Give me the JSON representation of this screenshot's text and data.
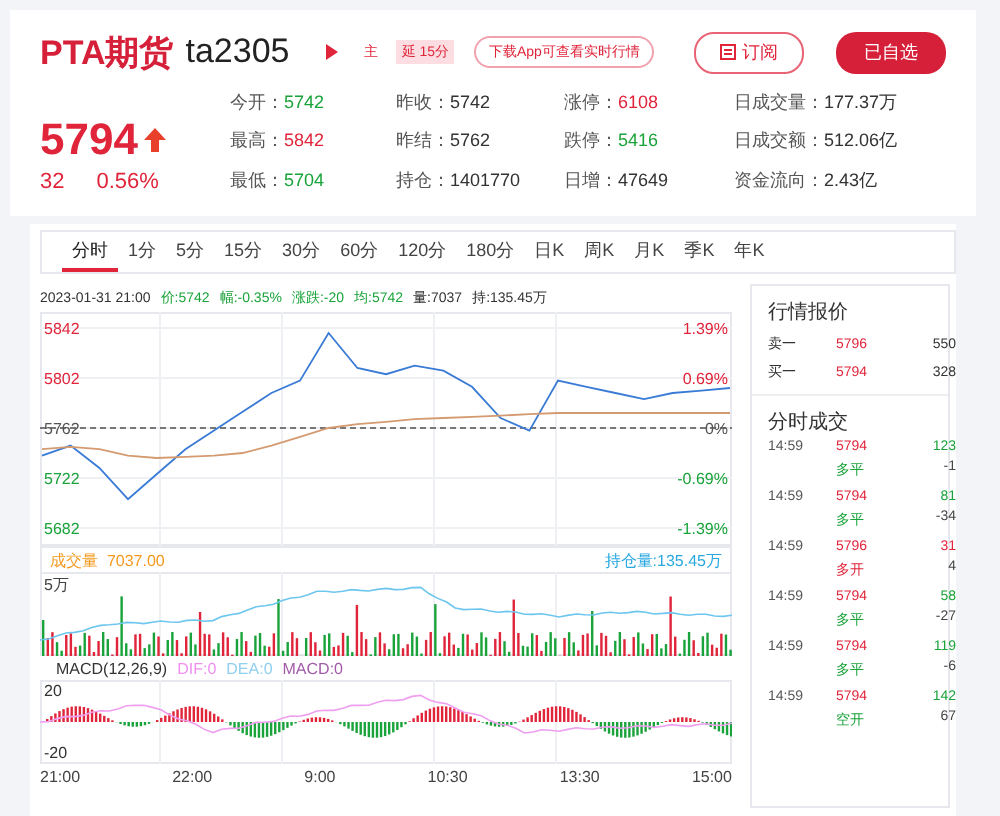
{
  "header": {
    "name": "PTA期货",
    "code": "ta2305",
    "badges": [
      {
        "text": "主",
        "kind": "plain"
      },
      {
        "text": "延 15分",
        "kind": "filled"
      }
    ],
    "promo": "下载App可查看实时行情",
    "subscribe_button": "订阅",
    "watchlist_button": "已自选"
  },
  "quote": {
    "price": "5794",
    "change": "32",
    "change_pct": "0.56%",
    "rising": true
  },
  "stats": [
    {
      "label": "今开：",
      "value": "5742",
      "color": "#1aa33a"
    },
    {
      "label": "昨收：",
      "value": "5742",
      "color": "#333333"
    },
    {
      "label": "涨停：",
      "value": "6108",
      "color": "#e0243a"
    },
    {
      "label": "日成交量：",
      "value": "177.37万",
      "color": "#333333"
    },
    {
      "label": "最高：",
      "value": "5842",
      "color": "#e0243a"
    },
    {
      "label": "昨结：",
      "value": "5762",
      "color": "#333333"
    },
    {
      "label": "跌停：",
      "value": "5416",
      "color": "#1aa33a"
    },
    {
      "label": "日成交额：",
      "value": "512.06亿",
      "color": "#333333"
    },
    {
      "label": "最低：",
      "value": "5704",
      "color": "#1aa33a"
    },
    {
      "label": "持仓：",
      "value": "1401770",
      "color": "#333333"
    },
    {
      "label": "日增：",
      "value": "47649",
      "color": "#333333"
    },
    {
      "label": "资金流向：",
      "value": "2.43亿",
      "color": "#333333"
    }
  ],
  "tabs": [
    {
      "label": "分时",
      "selected": true
    },
    {
      "label": "1分",
      "selected": false
    },
    {
      "label": "5分",
      "selected": false
    },
    {
      "label": "15分",
      "selected": false
    },
    {
      "label": "30分",
      "selected": false
    },
    {
      "label": "60分",
      "selected": false
    },
    {
      "label": "120分",
      "selected": false
    },
    {
      "label": "180分",
      "selected": false
    },
    {
      "label": "日K",
      "selected": false
    },
    {
      "label": "周K",
      "selected": false
    },
    {
      "label": "月K",
      "selected": false
    },
    {
      "label": "季K",
      "selected": false
    },
    {
      "label": "年K",
      "selected": false
    }
  ],
  "info_line": {
    "time": "2023-01-31 21:00",
    "items": [
      {
        "text": "价:5742",
        "color": "#1aa33a"
      },
      {
        "text": "幅:-0.35%",
        "color": "#1aa33a"
      },
      {
        "text": "涨跌:-20",
        "color": "#1aa33a"
      },
      {
        "text": "均:5742",
        "color": "#1aa33a"
      },
      {
        "text": "量:7037",
        "color": "#333333"
      },
      {
        "text": "持:135.45万",
        "color": "#333333"
      }
    ]
  },
  "price_chart": {
    "chart_data": {
      "type": "line",
      "categories": [
        null,
        null,
        null,
        null,
        null,
        null,
        null,
        null,
        null,
        null,
        null,
        null,
        null,
        null,
        null,
        null,
        null,
        null,
        null,
        null,
        null,
        null,
        null,
        null,
        null
      ],
      "ylim": [
        5682,
        5842
      ],
      "grid": true,
      "ref_lines": [
        {
          "axis": "y",
          "value": 5762
        }
      ],
      "yticks": [
        {
          "value": 5842,
          "label": "5842"
        },
        {
          "value": 5802,
          "label": "5802"
        },
        {
          "value": 5762,
          "label": "5762"
        },
        {
          "value": 5722,
          "label": "5722"
        },
        {
          "value": 5682,
          "label": "5682"
        }
      ],
      "series": [
        {
          "color": "#3a7bd5",
          "values": [
            5740,
            5748,
            5730,
            5705,
            5725,
            5745,
            5760,
            5775,
            5790,
            5800,
            5838,
            5810,
            5805,
            5812,
            5808,
            5795,
            5770,
            5760,
            5800,
            5795,
            5790,
            5785,
            5790,
            5792,
            5794
          ]
        },
        {
          "color": "#d49a70",
          "values": [
            5745,
            5747,
            5745,
            5740,
            5738,
            5739,
            5740,
            5742,
            5748,
            5755,
            5762,
            5765,
            5767,
            5769,
            5770,
            5771,
            5772,
            5773,
            5774,
            5774,
            5774,
            5774,
            5774,
            5774,
            5774
          ]
        }
      ]
    },
    "right_axis": [
      {
        "text": "1.39%",
        "color": "#e0243a"
      },
      {
        "text": "0.69%",
        "color": "#e0243a"
      },
      {
        "text": "0%",
        "color": "#555555"
      },
      {
        "text": "-0.69%",
        "color": "#1aa33a"
      },
      {
        "text": "-1.39%",
        "color": "#1aa33a"
      }
    ]
  },
  "volume": {
    "label": "成交量",
    "value": "7037.00",
    "axis": "5万",
    "open_interest": "持仓量:135.45万"
  },
  "macd": {
    "title": "MACD(12,26,9)",
    "dif": "DIF:0",
    "dea": "DEA:0",
    "macd": "MACD:0",
    "axis": [
      "20",
      "-20"
    ]
  },
  "time_axis": [
    "21:00",
    "22:00",
    "9:00",
    "10:30",
    "13:30",
    "15:00"
  ],
  "quote_panel": {
    "title": "行情报价",
    "book": [
      {
        "label": "卖一",
        "price": "5796",
        "volume": "550"
      },
      {
        "label": "买一",
        "price": "5794",
        "volume": "328"
      }
    ],
    "trades_title": "分时成交",
    "trades": [
      {
        "time": "14:59",
        "price": "5794",
        "volume": "123",
        "action": "多平",
        "color": "#1aa33a",
        "change": "-1"
      },
      {
        "time": "14:59",
        "price": "5794",
        "volume": "81",
        "action": "多平",
        "color": "#1aa33a",
        "change": "-34"
      },
      {
        "time": "14:59",
        "price": "5796",
        "volume": "31",
        "action": "多开",
        "color": "#e0243a",
        "change": "4"
      },
      {
        "time": "14:59",
        "price": "5794",
        "volume": "58",
        "action": "多平",
        "color": "#1aa33a",
        "change": "-27"
      },
      {
        "time": "14:59",
        "price": "5794",
        "volume": "119",
        "action": "多平",
        "color": "#1aa33a",
        "change": "-6"
      },
      {
        "time": "14:59",
        "price": "5794",
        "volume": "142",
        "action": "空开",
        "color": "#1aa33a",
        "change": "67"
      }
    ]
  }
}
